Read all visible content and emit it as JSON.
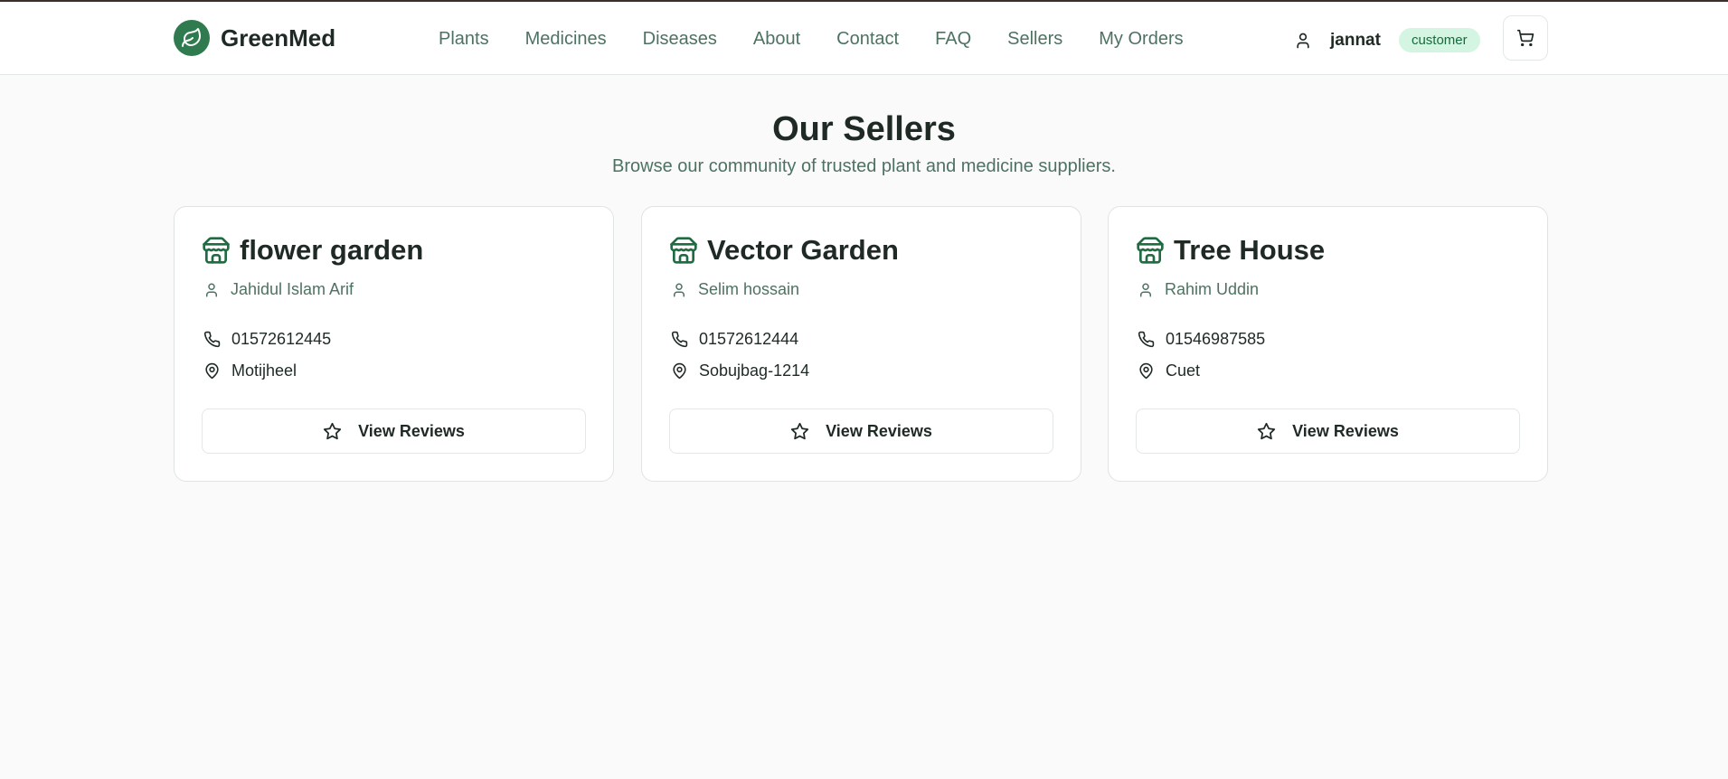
{
  "brand": {
    "name": "GreenMed",
    "icon": "leaf-icon",
    "color": "#2f7a4f"
  },
  "nav": [
    {
      "label": "Plants"
    },
    {
      "label": "Medicines"
    },
    {
      "label": "Diseases"
    },
    {
      "label": "About"
    },
    {
      "label": "Contact"
    },
    {
      "label": "FAQ"
    },
    {
      "label": "Sellers"
    },
    {
      "label": "My Orders"
    }
  ],
  "user": {
    "name": "jannat",
    "role": "customer",
    "icon": "user-icon"
  },
  "cart": {
    "icon": "cart-icon"
  },
  "page": {
    "title": "Our Sellers",
    "subtitle": "Browse our community of trusted plant and medicine suppliers."
  },
  "sellers": [
    {
      "shop": "flower garden",
      "owner": "Jahidul Islam Arif",
      "phone": "01572612445",
      "location": "Motijheel",
      "button": "View Reviews"
    },
    {
      "shop": "Vector Garden",
      "owner": "Selim hossain",
      "phone": "01572612444",
      "location": "Sobujbag-1214",
      "button": "View Reviews"
    },
    {
      "shop": "Tree House",
      "owner": "Rahim Uddin",
      "phone": "01546987585",
      "location": "Cuet",
      "button": "View Reviews"
    }
  ]
}
